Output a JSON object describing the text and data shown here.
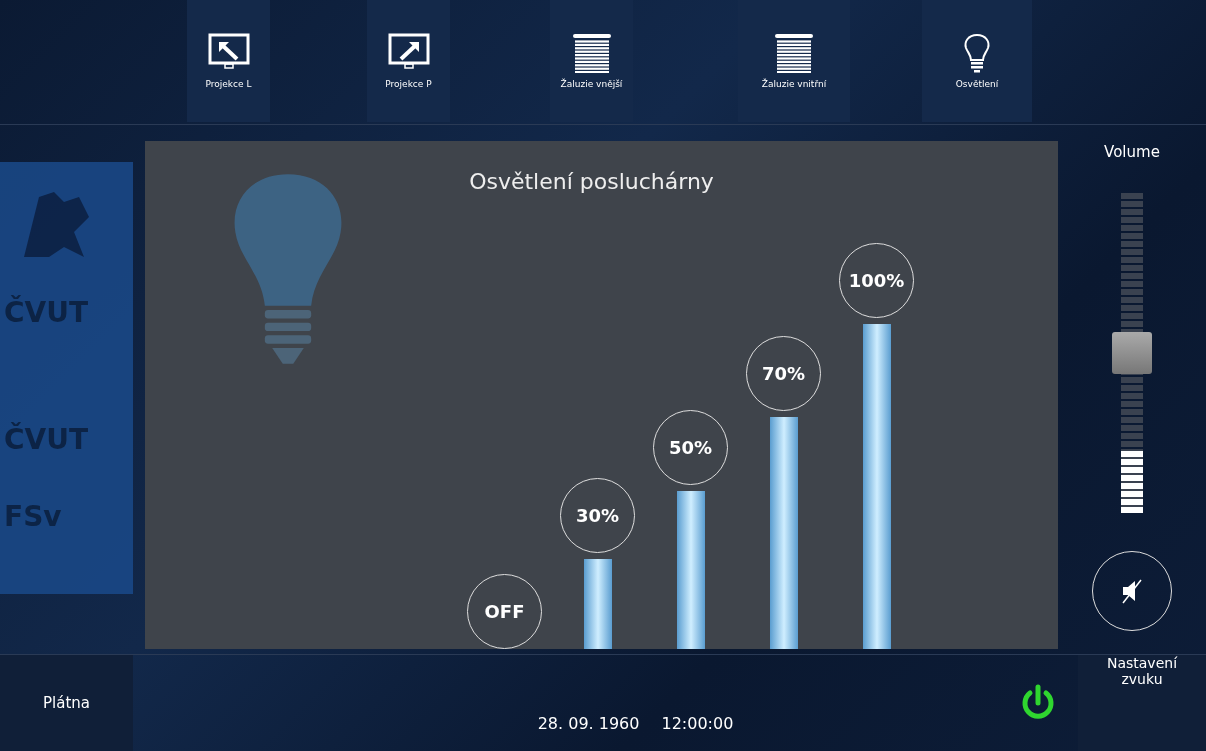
{
  "nav": [
    {
      "label": "Projekce L"
    },
    {
      "label": "Projekce P"
    },
    {
      "label": "Žaluzie vnější"
    },
    {
      "label": "Žaluzie vnitřní"
    },
    {
      "label": "Osvětlení"
    }
  ],
  "logo": {
    "lines": [
      "ČVUT",
      "ČVUT",
      "FSv"
    ]
  },
  "panel": {
    "title": "Osvětlení posluchárny",
    "levels": [
      {
        "label": "OFF"
      },
      {
        "label": "30%"
      },
      {
        "label": "50%"
      },
      {
        "label": "70%"
      },
      {
        "label": "100%"
      }
    ]
  },
  "volume": {
    "label": "Volume",
    "level": 0.5,
    "meter": {
      "level": 0.2
    },
    "muted": true
  },
  "footer": {
    "left_button": "Plátna",
    "date": "28. 09. 1960",
    "time": "12:00:00",
    "right_button": "Nastavení zvuku"
  }
}
